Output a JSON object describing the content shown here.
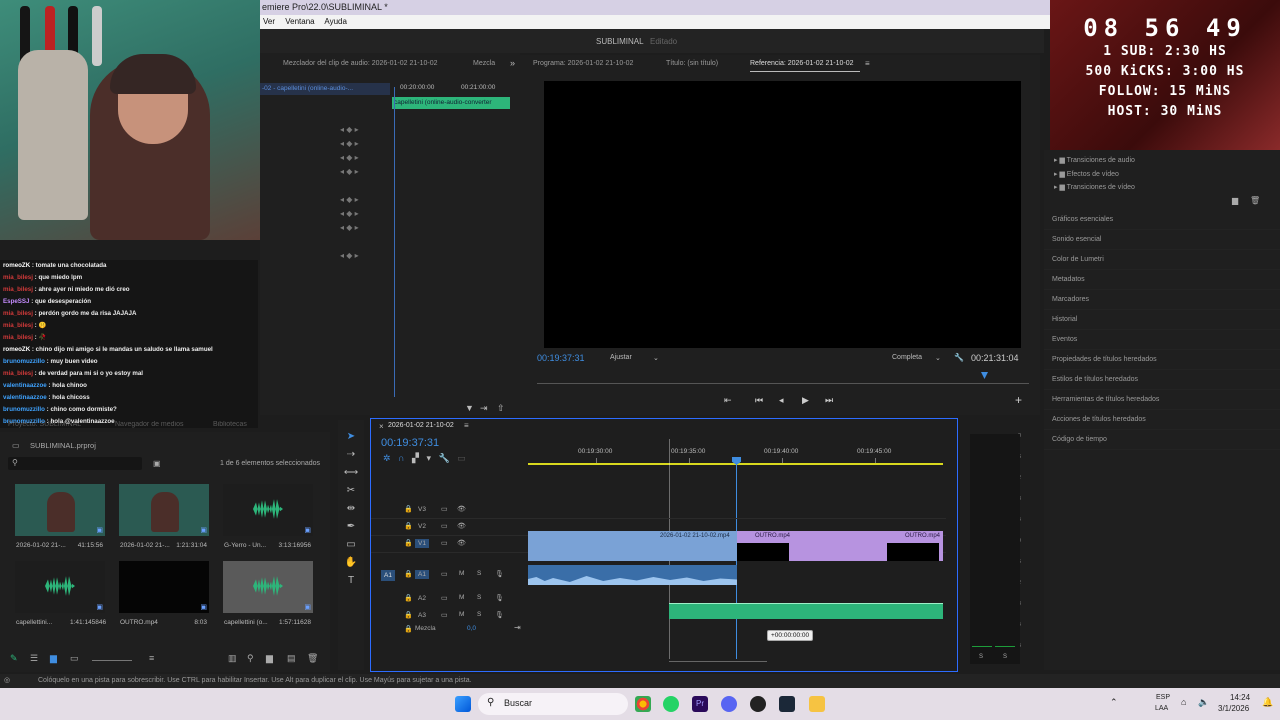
{
  "window": {
    "title": "emiere Pro\\22.0\\SUBLIMINAL *"
  },
  "menu": [
    "Ver",
    "Ventana",
    "Ayuda"
  ],
  "workspace": {
    "project_name": "SUBLIMINAL",
    "state": "Editado"
  },
  "source_panel": {
    "tabs": [
      "Mezclador del clip de audio: 2026-01-02 21-10-02",
      "Mezcla"
    ],
    "track_label": "-02 - capelletini (online-audio-...",
    "clip_label": "capelletini (online-audio-converter",
    "ruler": [
      "00:20:00:00",
      "00:21:00:00"
    ]
  },
  "program_panel": {
    "tabs": [
      "Programa: 2026-01-02 21-10-02",
      "Título: (sin título)",
      "Referencia: 2026-01-02 21-10-02"
    ],
    "timecode": "00:19:37:31",
    "fit": "Ajustar",
    "quality": "Completa",
    "duration": "00:21:31:04"
  },
  "effects": {
    "items": [
      "Transiciones de audio",
      "Efectos de vídeo",
      "Transiciones de vídeo"
    ]
  },
  "right_panels": [
    "Gráficos esenciales",
    "Sonido esencial",
    "Color de Lumetri",
    "Metadatos",
    "Marcadores",
    "Historial",
    "Eventos",
    "Propiedades de títulos heredados",
    "Estilos de títulos heredados",
    "Herramientas de títulos heredados",
    "Acciones de títulos heredados",
    "Código de tiempo"
  ],
  "overlay": {
    "clock": "08 56 49",
    "goals": [
      "1 SUB: 2:30 HS",
      "500 KiCKS: 3:00 HS",
      "FOLLOW: 15 MiNS",
      "HOST: 30 MiNS"
    ]
  },
  "chat": [
    {
      "user": "romeoZK",
      "color": "#ffffff",
      "msg": "tomate una chocolatada"
    },
    {
      "user": "mia_bilesj",
      "color": "#d23a3a",
      "msg": "que miedo lpm"
    },
    {
      "user": "mia_bilesj",
      "color": "#d23a3a",
      "msg": "ahre ayer ni miedo me dió creo"
    },
    {
      "user": "EspeSSJ",
      "color": "#c58cff",
      "msg": "que desesperación"
    },
    {
      "user": "mia_bilesj",
      "color": "#d23a3a",
      "msg": "perdón gordo me da risa JAJAJA"
    },
    {
      "user": "mia_bilesj",
      "color": "#d23a3a",
      "msg": "🤫"
    },
    {
      "user": "mia_bilesj",
      "color": "#d23a3a",
      "msg": "🥀"
    },
    {
      "user": "romeoZK",
      "color": "#ffffff",
      "msg": "chino dijo mi amigo si le mandas un saludo se llama samuel"
    },
    {
      "user": "brunomuzzillo",
      "color": "#3fa3ff",
      "msg": "muy buen video"
    },
    {
      "user": "mia_bilesj",
      "color": "#d23a3a",
      "msg": "de verdad para mi si o yo estoy mal"
    },
    {
      "user": "valentinaazzoe",
      "color": "#3fa3ff",
      "msg": "hola chinoo"
    },
    {
      "user": "valentinaazzoe",
      "color": "#3fa3ff",
      "msg": "hola chicoss"
    },
    {
      "user": "brunomuzzillo",
      "color": "#3fa3ff",
      "msg": "chino como dormiste?"
    },
    {
      "user": "brunomuzzillo",
      "color": "#3fa3ff",
      "msg": "hola @valentinaazzoe"
    }
  ],
  "project": {
    "tabs": [
      "Proyecto: SUBLIMINAL",
      "Navegador de medios",
      "Bibliotecas"
    ],
    "file": "SUBLIMINAL.prproj",
    "selection": "1 de 6 elementos seleccionados",
    "items": [
      {
        "name": "2026-01-02 21-...",
        "dur": "41:15:56",
        "kind": "video"
      },
      {
        "name": "2026-01-02 21-...",
        "dur": "1:21:31:04",
        "kind": "video"
      },
      {
        "name": "G-Yerro - Un...",
        "dur": "3:13:16956",
        "kind": "audio"
      },
      {
        "name": "capellettini...",
        "dur": "1:41:145846",
        "kind": "audio"
      },
      {
        "name": "OUTRO.mp4",
        "dur": "8:03",
        "kind": "black"
      },
      {
        "name": "capellettini (o...",
        "dur": "1:57:11628",
        "kind": "audio"
      }
    ]
  },
  "timeline": {
    "sequence": "2026-01-02 21-10-02",
    "timecode": "00:19:37:31",
    "ruler": [
      "00:19:30:00",
      "00:19:35:00",
      "00:19:40:00",
      "00:19:45:00"
    ],
    "tracks_v": [
      "V3",
      "V2",
      "V1"
    ],
    "tracks_a": [
      "A1",
      "A2",
      "A3"
    ],
    "mix_label": "Mezcla",
    "mix_value": "0,0",
    "clips": {
      "v1a": "2026-01-02 21-10-02.mp4",
      "v1b": "OUTRO.mp4",
      "v1c": "OUTRO.mp4"
    },
    "tooltip": "+00:00:00:00",
    "meter": [
      "0",
      "-6",
      "-12",
      "-18",
      "-24",
      "-30",
      "-36",
      "-42",
      "-48",
      "-54",
      "-dB"
    ],
    "meter_sr": [
      "S",
      "S"
    ]
  },
  "status": "Colóquelo en una pista para sobrescribir. Use CTRL para habilitar Insertar. Use Alt para duplicar el clip. Use Mayús para sujetar a una pista.",
  "taskbar": {
    "search": "Buscar",
    "lang1": "ESP",
    "lang2": "LAA",
    "time": "14:24",
    "date": "3/1/2026"
  }
}
